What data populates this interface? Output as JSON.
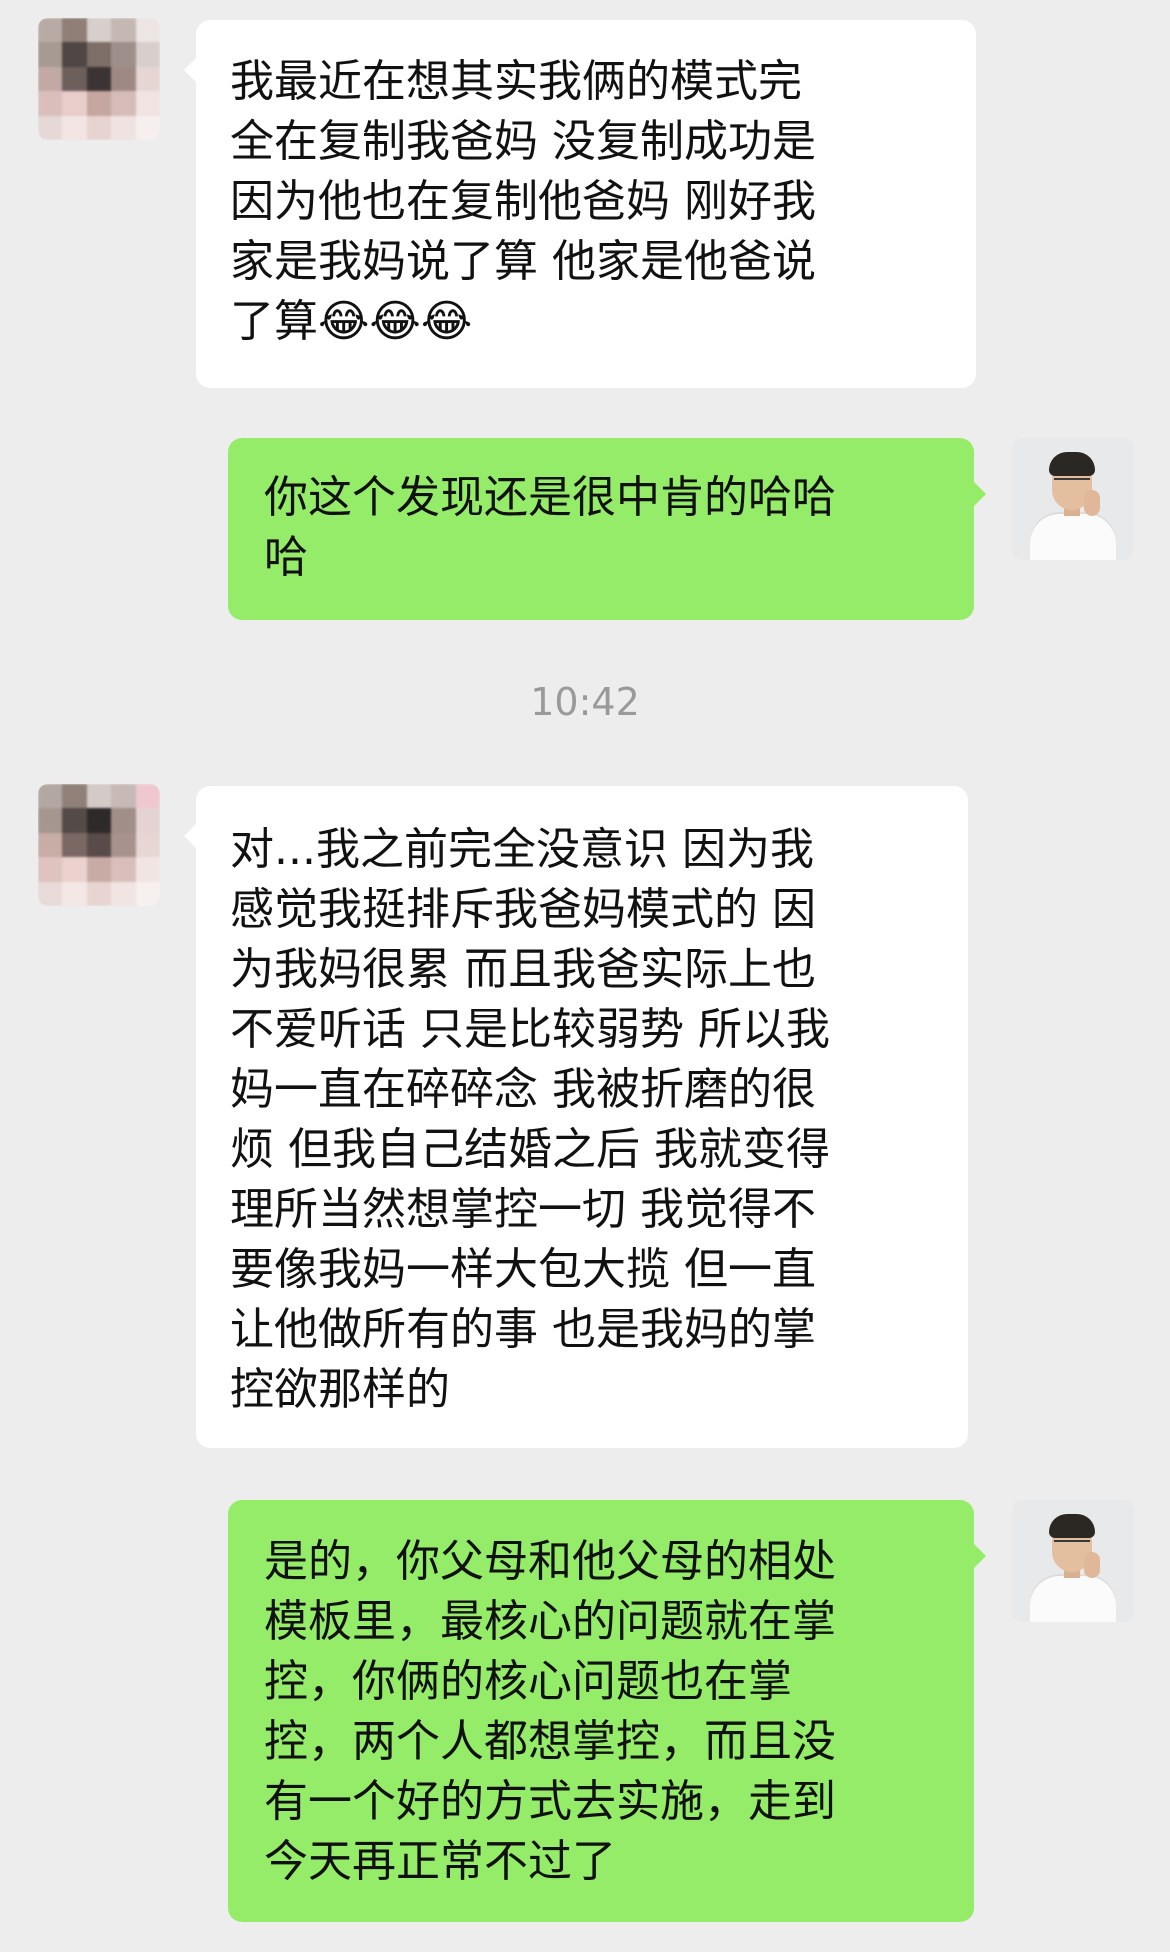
{
  "messages": [
    {
      "sender": "other",
      "lines": [
        "我最近在想其实我俩的模式完",
        "全在复制我爸妈 没复制成功是",
        "因为他也在复制他爸妈 刚好我",
        "家是我妈说了算 他家是他爸说",
        "了算😂😂😂"
      ]
    },
    {
      "sender": "me",
      "lines": [
        "你这个发现还是很中肯的哈哈",
        "哈"
      ]
    },
    {
      "sender": "other",
      "lines": [
        "对...我之前完全没意识 因为我",
        "感觉我挺排斥我爸妈模式的 因",
        "为我妈很累 而且我爸实际上也",
        "不爱听话 只是比较弱势 所以我",
        "妈一直在碎碎念 我被折磨的很",
        "烦 但我自己结婚之后 我就变得",
        "理所当然想掌控一切 我觉得不",
        "要像我妈一样大包大揽 但一直",
        "让他做所有的事 也是我妈的掌",
        "控欲那样的"
      ]
    },
    {
      "sender": "me",
      "lines": [
        "是的，你父母和他父母的相处",
        "模板里，最核心的问题就在掌",
        "控，你俩的核心问题也在掌",
        "控，两个人都想掌控，而且没",
        "有一个好的方式去实施，走到",
        "今天再正常不过了"
      ]
    }
  ],
  "timestamp": "10:42",
  "colors": {
    "background": "#ededed",
    "bubble_other": "#ffffff",
    "bubble_me": "#95ec69",
    "timestamp": "#9a9a9a"
  },
  "icons": {
    "emoji": "face-with-tears-of-joy"
  }
}
